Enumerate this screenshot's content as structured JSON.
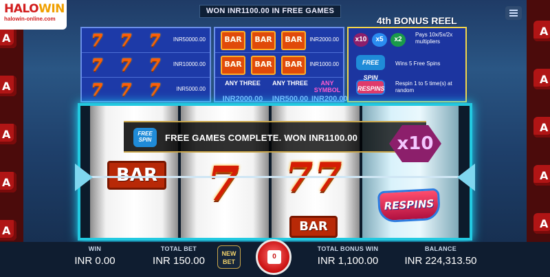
{
  "logo": {
    "word_a": "HALO",
    "word_b": "WIN",
    "url": "halowin-online.com"
  },
  "top_banner": "WON INR1100.00 IN FREE GAMES",
  "paytable": {
    "sevens": [
      {
        "value": "INR50000.00"
      },
      {
        "value": "INR10000.00"
      },
      {
        "value": "INR5000.00"
      }
    ],
    "bars": [
      {
        "value": "INR2000.00"
      },
      {
        "value": "INR1000.00"
      }
    ],
    "any": [
      {
        "title": "ANY THREE",
        "value": "INR2000.00"
      },
      {
        "title": "ANY THREE",
        "value": "INR500.00"
      },
      {
        "title": "ANY SYMBOL",
        "value": "INR200.00"
      }
    ],
    "bar_label": "BAR",
    "seven_glyph": "7"
  },
  "bonus_reel": {
    "title": "4th BONUS REEL",
    "multipliers": [
      "x10",
      "x5",
      "x2"
    ],
    "multiplier_text": "Pays 10x/5x/2x multipliers",
    "free_spin_badge": "FREE SPIN",
    "free_spin_text": "Wins 5 Free Spins",
    "respin_badge": "RESPINS",
    "respin_text": "Respin 1 to 5 time(s) at random"
  },
  "reels": {
    "bar_label": "BAR",
    "seven_glyph": "7",
    "respins_label": "RESPINS",
    "multiplier": "x10"
  },
  "overlay": {
    "badge": "FREE SPIN",
    "text": "FREE GAMES COMPLETE. WON INR1100.00"
  },
  "bottom": {
    "win_label": "WIN",
    "win_value": "INR 0.00",
    "bet_label": "TOTAL BET",
    "bet_value": "INR 150.00",
    "new_bet": "NEW BET",
    "spin_count": "0",
    "bonus_label": "TOTAL BONUS WIN",
    "bonus_value": "INR 1,100.00",
    "balance_label": "BALANCE",
    "balance_value": "INR 224,313.50"
  }
}
